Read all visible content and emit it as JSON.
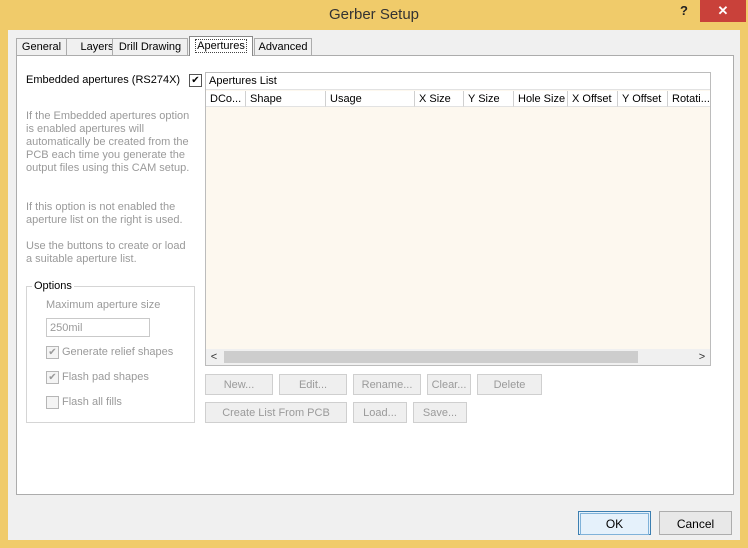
{
  "window": {
    "title": "Gerber Setup",
    "help_label": "?",
    "close_label": "✕"
  },
  "tabs": [
    {
      "label": "General"
    },
    {
      "label": "Layers"
    },
    {
      "label": "Drill Drawing"
    },
    {
      "label": "Apertures"
    },
    {
      "label": "Advanced"
    }
  ],
  "embedded": {
    "label": "Embedded apertures (RS274X)",
    "checked": true,
    "check_glyph": "✔"
  },
  "help_text": {
    "p1": "If the Embedded apertures option is enabled apertures will automatically be created from the PCB each time you generate the output files using this CAM setup.",
    "p2": "If this option is not enabled the aperture list on the right is used.",
    "p3": "Use the buttons to create or load a suitable aperture list."
  },
  "options": {
    "title": "Options",
    "max_aperture_label": "Maximum aperture size",
    "max_aperture_value": "250mil",
    "relief_label": "Generate relief shapes",
    "flash_pad_label": "Flash pad shapes",
    "flash_fills_label": "Flash all fills",
    "check_glyph": "✔"
  },
  "apertures_list": {
    "title": "Apertures List",
    "columns": [
      "DCo...",
      "Shape",
      "Usage",
      "X Size",
      "Y Size",
      "Hole Size",
      "X Offset",
      "Y Offset",
      "Rotati..."
    ],
    "scroll_left": "<",
    "scroll_right": ">"
  },
  "buttons": {
    "new": "New...",
    "edit": "Edit...",
    "rename": "Rename...",
    "clear": "Clear...",
    "delete": "Delete",
    "create_from_pcb": "Create List From PCB",
    "load": "Load...",
    "save": "Save..."
  },
  "footer": {
    "ok": "OK",
    "cancel": "Cancel"
  },
  "colors": {
    "frame": "#f0cb6a",
    "close": "#c9413a",
    "list_bg": "#fdf8ef"
  }
}
